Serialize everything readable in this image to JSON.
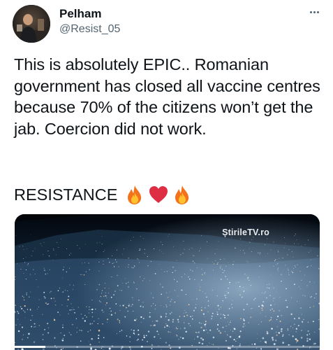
{
  "author": {
    "name": "Pelham",
    "handle": "@Resist_05",
    "avatar_icon": "profile-photo"
  },
  "tweet": {
    "text": "This is absolutely EPIC.. Romanian government has closed all vaccine centres because 70% of the citizens won’t get the jab. Coercion did not work.",
    "resist_word": "RESISTANCE",
    "emojis": [
      "fire-emoji",
      "red-heart-emoji",
      "fire-emoji"
    ]
  },
  "media": {
    "watermark": "ȘtirileTV.ro",
    "progress": 0.1
  },
  "menu": {
    "icon": "more-options-icon"
  },
  "colors": {
    "text": "#0f1419",
    "secondary": "#536471",
    "background": "#ffffff"
  }
}
